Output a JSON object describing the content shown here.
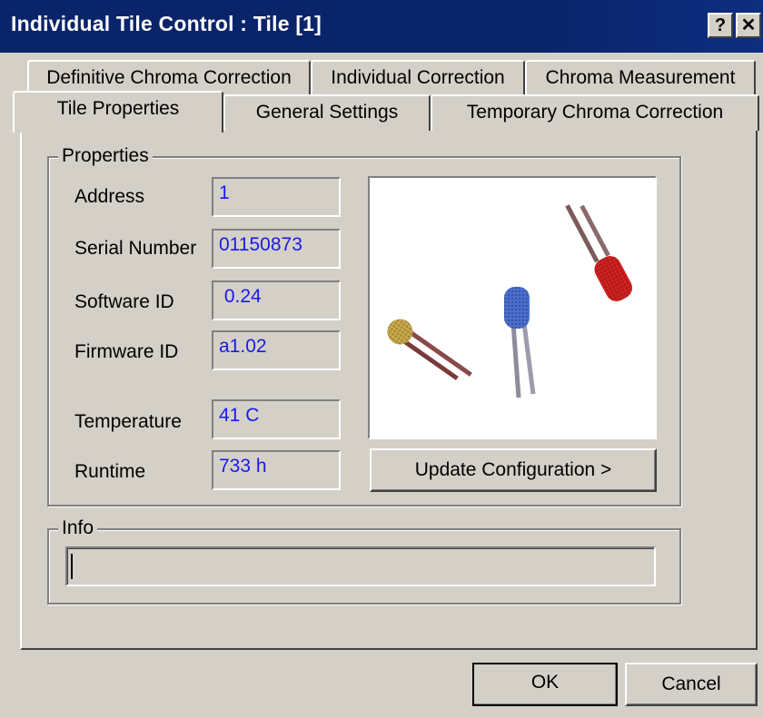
{
  "window": {
    "title": "Individual Tile Control : Tile [1]",
    "help_glyph": "?",
    "close_glyph": "✕"
  },
  "tabs": {
    "row_back": [
      "Definitive Chroma Correction",
      "Individual Correction",
      "Chroma Measurement"
    ],
    "row_front": [
      "Tile Properties",
      "General Settings",
      "Temporary Chroma Correction"
    ],
    "active": "Tile Properties"
  },
  "properties": {
    "legend": "Properties",
    "fields": [
      {
        "label": "Address",
        "value": "1"
      },
      {
        "label": "Serial Number",
        "value": "01150873"
      },
      {
        "label": "Software ID",
        "value": " 0.24"
      },
      {
        "label": "Firmware ID",
        "value": "a1.02"
      },
      {
        "label": "Temperature",
        "value": "41 C"
      },
      {
        "label": "Runtime",
        "value": "733 h"
      }
    ],
    "image": {
      "subject": "three-leds-photo",
      "led_colors": [
        "#c8a84a",
        "#4a6fd0",
        "#d02020"
      ]
    },
    "update_button": "Update Configuration >"
  },
  "info": {
    "legend": "Info",
    "value": ""
  },
  "footer": {
    "ok": "OK",
    "cancel": "Cancel"
  },
  "colors": {
    "titlebar": "#0a246a",
    "face": "#d4d0c8",
    "value_text": "#1a1ae6"
  }
}
